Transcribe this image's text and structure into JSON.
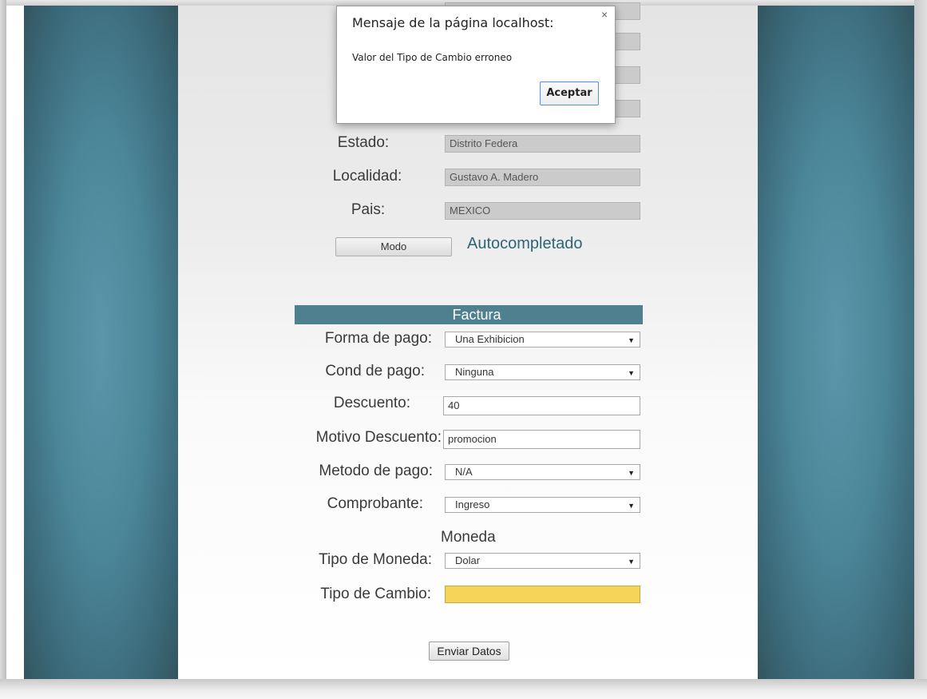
{
  "address": {
    "estado": {
      "label": "Estado:",
      "value": "Distrito Federa"
    },
    "localidad": {
      "label": "Localidad:",
      "value": "Gustavo A. Madero"
    },
    "pais": {
      "label": "Pais:",
      "value": "MEXICO"
    },
    "modo_button": "Modo",
    "mode_status": "Autocompletado"
  },
  "factura": {
    "title": "Factura",
    "forma_pago": {
      "label": "Forma de pago:",
      "value": "Una Exhibicion"
    },
    "cond_pago": {
      "label": "Cond de pago:",
      "value": "Ninguna"
    },
    "descuento": {
      "label": "Descuento:",
      "value": "40"
    },
    "motivo_descuento": {
      "label": "Motivo Descuento:",
      "value": "promocion"
    },
    "metodo_pago": {
      "label": "Metodo de pago:",
      "value": "N/A"
    },
    "comprobante": {
      "label": "Comprobante:",
      "value": "Ingreso"
    }
  },
  "moneda": {
    "title": "Moneda",
    "tipo_moneda": {
      "label": "Tipo de Moneda:",
      "value": "Dolar"
    },
    "tipo_cambio": {
      "label": "Tipo de Cambio:",
      "value": ""
    }
  },
  "submit_button": "Enviar Datos",
  "dialog": {
    "title": "Mensaje de la página localhost:",
    "message": "Valor del Tipo de Cambio erroneo",
    "ok_button": "Aceptar",
    "close_glyph": "×"
  },
  "icons": {
    "select_arrow": "▼"
  },
  "colors": {
    "section_bar": "#4e8090",
    "mode_status_text": "#2f6675",
    "error_field": "#f5d457",
    "side_background": "#4b8598"
  }
}
